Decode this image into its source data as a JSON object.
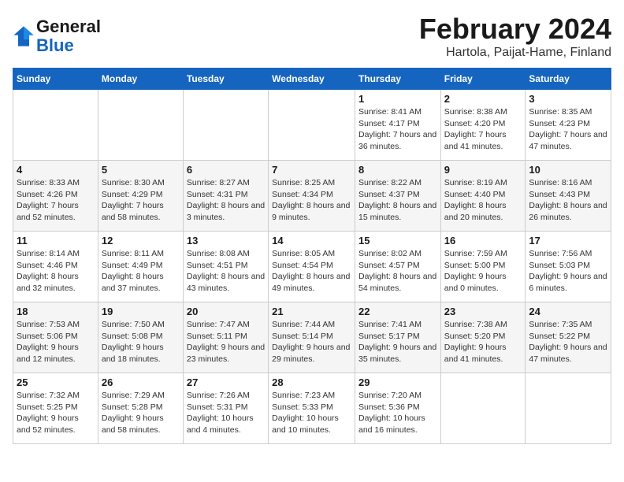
{
  "header": {
    "logo_line1": "General",
    "logo_line2": "Blue",
    "title": "February 2024",
    "subtitle": "Hartola, Paijat-Hame, Finland"
  },
  "weekdays": [
    "Sunday",
    "Monday",
    "Tuesday",
    "Wednesday",
    "Thursday",
    "Friday",
    "Saturday"
  ],
  "weeks": [
    [
      {
        "day": "",
        "sunrise": "",
        "sunset": "",
        "daylight": ""
      },
      {
        "day": "",
        "sunrise": "",
        "sunset": "",
        "daylight": ""
      },
      {
        "day": "",
        "sunrise": "",
        "sunset": "",
        "daylight": ""
      },
      {
        "day": "",
        "sunrise": "",
        "sunset": "",
        "daylight": ""
      },
      {
        "day": "1",
        "sunrise": "Sunrise: 8:41 AM",
        "sunset": "Sunset: 4:17 PM",
        "daylight": "Daylight: 7 hours and 36 minutes."
      },
      {
        "day": "2",
        "sunrise": "Sunrise: 8:38 AM",
        "sunset": "Sunset: 4:20 PM",
        "daylight": "Daylight: 7 hours and 41 minutes."
      },
      {
        "day": "3",
        "sunrise": "Sunrise: 8:35 AM",
        "sunset": "Sunset: 4:23 PM",
        "daylight": "Daylight: 7 hours and 47 minutes."
      }
    ],
    [
      {
        "day": "4",
        "sunrise": "Sunrise: 8:33 AM",
        "sunset": "Sunset: 4:26 PM",
        "daylight": "Daylight: 7 hours and 52 minutes."
      },
      {
        "day": "5",
        "sunrise": "Sunrise: 8:30 AM",
        "sunset": "Sunset: 4:29 PM",
        "daylight": "Daylight: 7 hours and 58 minutes."
      },
      {
        "day": "6",
        "sunrise": "Sunrise: 8:27 AM",
        "sunset": "Sunset: 4:31 PM",
        "daylight": "Daylight: 8 hours and 3 minutes."
      },
      {
        "day": "7",
        "sunrise": "Sunrise: 8:25 AM",
        "sunset": "Sunset: 4:34 PM",
        "daylight": "Daylight: 8 hours and 9 minutes."
      },
      {
        "day": "8",
        "sunrise": "Sunrise: 8:22 AM",
        "sunset": "Sunset: 4:37 PM",
        "daylight": "Daylight: 8 hours and 15 minutes."
      },
      {
        "day": "9",
        "sunrise": "Sunrise: 8:19 AM",
        "sunset": "Sunset: 4:40 PM",
        "daylight": "Daylight: 8 hours and 20 minutes."
      },
      {
        "day": "10",
        "sunrise": "Sunrise: 8:16 AM",
        "sunset": "Sunset: 4:43 PM",
        "daylight": "Daylight: 8 hours and 26 minutes."
      }
    ],
    [
      {
        "day": "11",
        "sunrise": "Sunrise: 8:14 AM",
        "sunset": "Sunset: 4:46 PM",
        "daylight": "Daylight: 8 hours and 32 minutes."
      },
      {
        "day": "12",
        "sunrise": "Sunrise: 8:11 AM",
        "sunset": "Sunset: 4:49 PM",
        "daylight": "Daylight: 8 hours and 37 minutes."
      },
      {
        "day": "13",
        "sunrise": "Sunrise: 8:08 AM",
        "sunset": "Sunset: 4:51 PM",
        "daylight": "Daylight: 8 hours and 43 minutes."
      },
      {
        "day": "14",
        "sunrise": "Sunrise: 8:05 AM",
        "sunset": "Sunset: 4:54 PM",
        "daylight": "Daylight: 8 hours and 49 minutes."
      },
      {
        "day": "15",
        "sunrise": "Sunrise: 8:02 AM",
        "sunset": "Sunset: 4:57 PM",
        "daylight": "Daylight: 8 hours and 54 minutes."
      },
      {
        "day": "16",
        "sunrise": "Sunrise: 7:59 AM",
        "sunset": "Sunset: 5:00 PM",
        "daylight": "Daylight: 9 hours and 0 minutes."
      },
      {
        "day": "17",
        "sunrise": "Sunrise: 7:56 AM",
        "sunset": "Sunset: 5:03 PM",
        "daylight": "Daylight: 9 hours and 6 minutes."
      }
    ],
    [
      {
        "day": "18",
        "sunrise": "Sunrise: 7:53 AM",
        "sunset": "Sunset: 5:06 PM",
        "daylight": "Daylight: 9 hours and 12 minutes."
      },
      {
        "day": "19",
        "sunrise": "Sunrise: 7:50 AM",
        "sunset": "Sunset: 5:08 PM",
        "daylight": "Daylight: 9 hours and 18 minutes."
      },
      {
        "day": "20",
        "sunrise": "Sunrise: 7:47 AM",
        "sunset": "Sunset: 5:11 PM",
        "daylight": "Daylight: 9 hours and 23 minutes."
      },
      {
        "day": "21",
        "sunrise": "Sunrise: 7:44 AM",
        "sunset": "Sunset: 5:14 PM",
        "daylight": "Daylight: 9 hours and 29 minutes."
      },
      {
        "day": "22",
        "sunrise": "Sunrise: 7:41 AM",
        "sunset": "Sunset: 5:17 PM",
        "daylight": "Daylight: 9 hours and 35 minutes."
      },
      {
        "day": "23",
        "sunrise": "Sunrise: 7:38 AM",
        "sunset": "Sunset: 5:20 PM",
        "daylight": "Daylight: 9 hours and 41 minutes."
      },
      {
        "day": "24",
        "sunrise": "Sunrise: 7:35 AM",
        "sunset": "Sunset: 5:22 PM",
        "daylight": "Daylight: 9 hours and 47 minutes."
      }
    ],
    [
      {
        "day": "25",
        "sunrise": "Sunrise: 7:32 AM",
        "sunset": "Sunset: 5:25 PM",
        "daylight": "Daylight: 9 hours and 52 minutes."
      },
      {
        "day": "26",
        "sunrise": "Sunrise: 7:29 AM",
        "sunset": "Sunset: 5:28 PM",
        "daylight": "Daylight: 9 hours and 58 minutes."
      },
      {
        "day": "27",
        "sunrise": "Sunrise: 7:26 AM",
        "sunset": "Sunset: 5:31 PM",
        "daylight": "Daylight: 10 hours and 4 minutes."
      },
      {
        "day": "28",
        "sunrise": "Sunrise: 7:23 AM",
        "sunset": "Sunset: 5:33 PM",
        "daylight": "Daylight: 10 hours and 10 minutes."
      },
      {
        "day": "29",
        "sunrise": "Sunrise: 7:20 AM",
        "sunset": "Sunset: 5:36 PM",
        "daylight": "Daylight: 10 hours and 16 minutes."
      },
      {
        "day": "",
        "sunrise": "",
        "sunset": "",
        "daylight": ""
      },
      {
        "day": "",
        "sunrise": "",
        "sunset": "",
        "daylight": ""
      }
    ]
  ]
}
